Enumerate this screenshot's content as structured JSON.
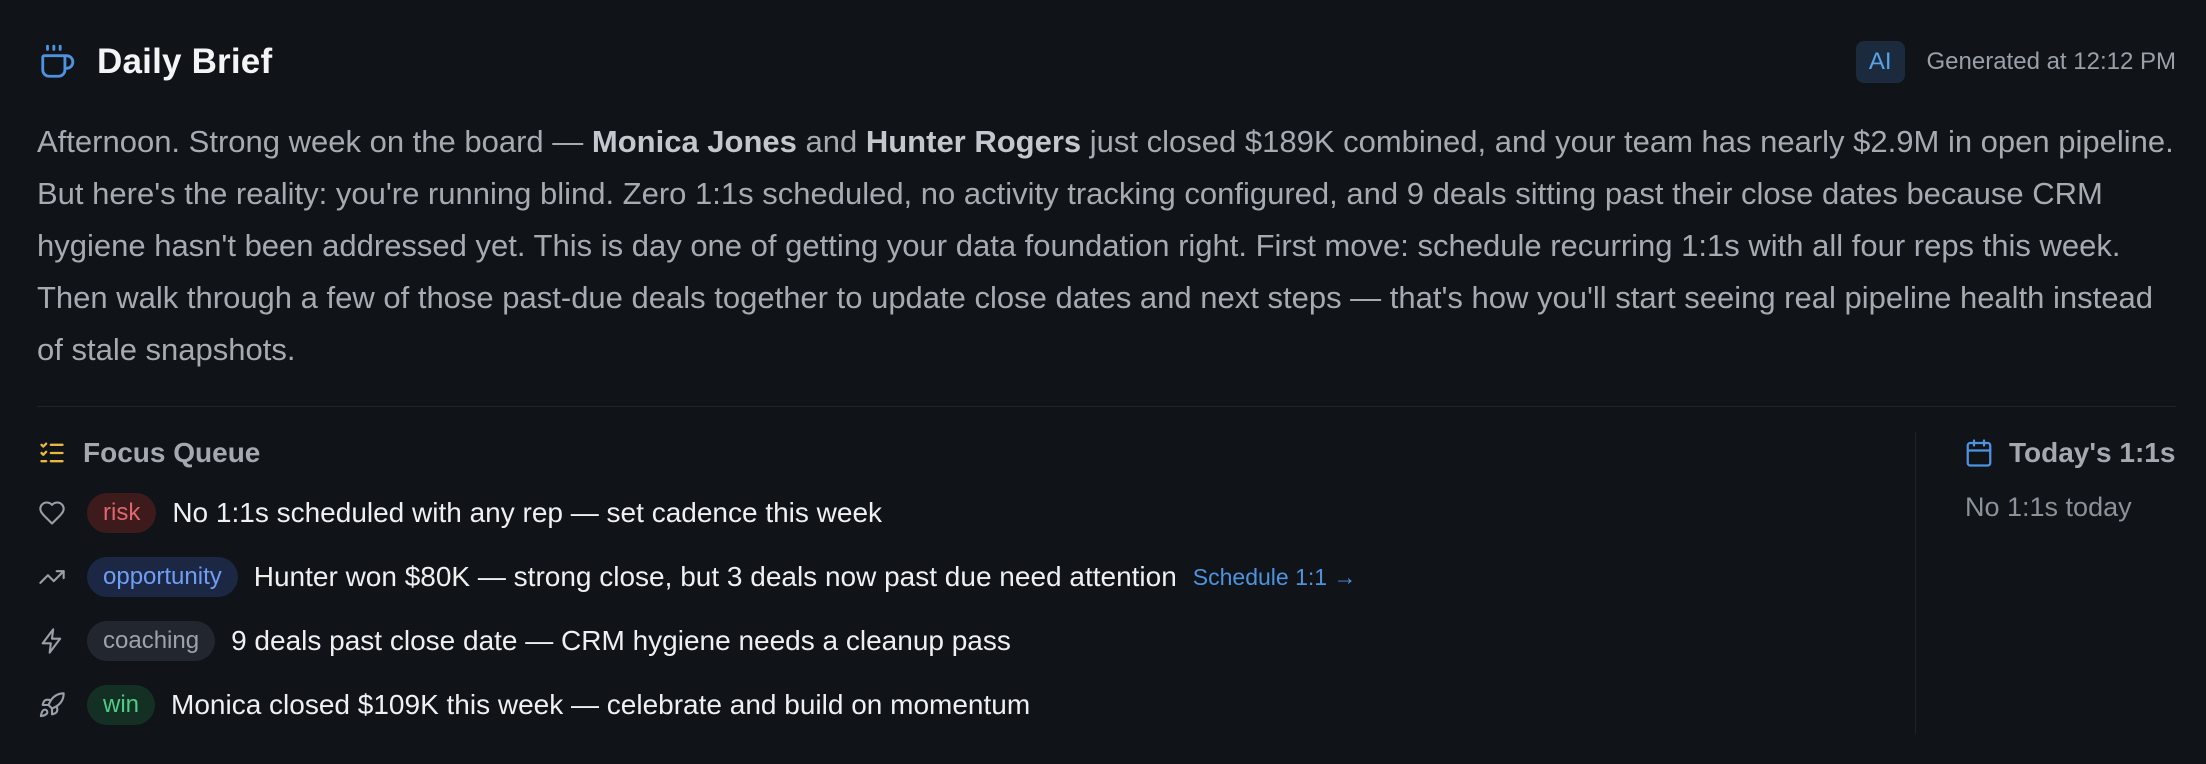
{
  "header": {
    "title": "Daily Brief",
    "ai_label": "AI",
    "generated": "Generated at 12:12 PM",
    "icon": "coffee-cup-icon"
  },
  "summary": {
    "p1": "Afternoon. Strong week on the board — ",
    "name1": "Monica Jones",
    "p2": " and ",
    "name2": "Hunter Rogers",
    "p3": " just closed $189K combined, and your team has nearly $2.9M in open pipeline. But here's the reality: you're running blind. Zero 1:1s scheduled, no activity tracking configured, and 9 deals sitting past their close dates because CRM hygiene hasn't been addressed yet. This is day one of getting your data foundation right. First move: schedule recurring 1:1s with all four reps this week. Then walk through a few of those past-due deals together to update close dates and next steps — that's how you'll start seeing real pipeline health instead of stale snapshots."
  },
  "focus_queue": {
    "title": "Focus Queue",
    "icon": "checklist-icon",
    "items": [
      {
        "icon": "heart-icon",
        "badge": "risk",
        "text": "No 1:1s scheduled with any rep — set cadence this week"
      },
      {
        "icon": "trending-up-icon",
        "badge": "opportunity",
        "text": "Hunter won $80K — strong close, but 3 deals now past due need attention",
        "link": "Schedule 1:1 →"
      },
      {
        "icon": "lightning-icon",
        "badge": "coaching",
        "text": "9 deals past close date — CRM hygiene needs a cleanup pass"
      },
      {
        "icon": "rocket-icon",
        "badge": "win",
        "text": "Monica closed $109K this week — celebrate and build on momentum"
      }
    ]
  },
  "todays_ones": {
    "title": "Today's 1:1s",
    "icon": "calendar-icon",
    "empty": "No 1:1s today"
  },
  "colors": {
    "background": "#101318",
    "accent_blue": "#4d93e0",
    "risk": "#e0656d",
    "opportunity": "#6f9ef5",
    "coaching": "#9ca3ab",
    "win": "#4ecb85",
    "focus_icon": "#e8b93c"
  }
}
